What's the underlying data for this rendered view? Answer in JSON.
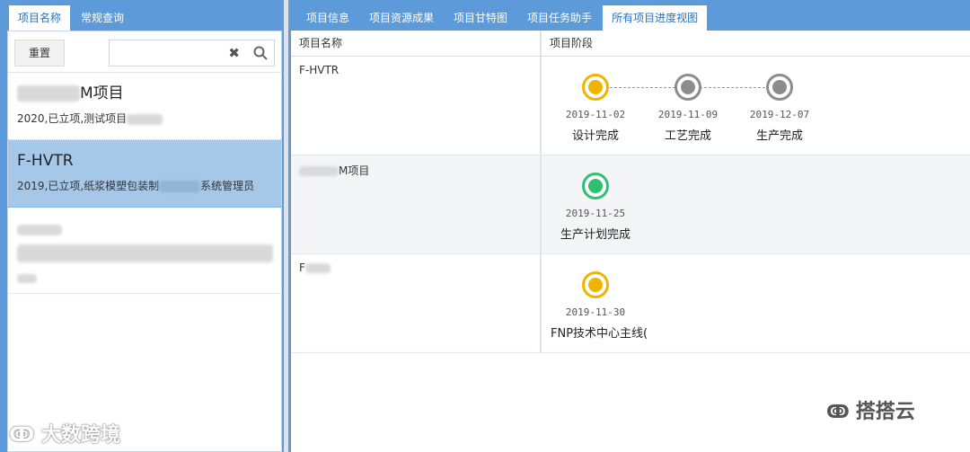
{
  "left_panel": {
    "tabs": [
      {
        "label": "项目名称",
        "active": true
      },
      {
        "label": "常规查询",
        "active": false
      }
    ],
    "reset_label": "重置",
    "search_value": "",
    "clear_icon": "✖",
    "projects": [
      {
        "title_suffix": "M项目",
        "subtitle": "2020,已立项,测试项目",
        "selected": false
      },
      {
        "title": "F-HVTR",
        "subtitle_a": "2019,已立项,纸浆模塑包装制",
        "subtitle_b": "系统管理员",
        "selected": true
      }
    ]
  },
  "right_panel": {
    "tabs": [
      {
        "label": "项目信息",
        "active": false
      },
      {
        "label": "项目资源成果",
        "active": false
      },
      {
        "label": "项目甘特图",
        "active": false
      },
      {
        "label": "项目任务助手",
        "active": false
      },
      {
        "label": "所有项目进度视图",
        "active": true
      }
    ],
    "columns": {
      "name": "项目名称",
      "stage": "项目阶段"
    },
    "rows": [
      {
        "name": "F-HVTR",
        "milestones": [
          {
            "date": "2019-11-02",
            "label": "设计完成",
            "color": "#f0b400"
          },
          {
            "date": "2019-11-09",
            "label": "工艺完成",
            "color": "#8c8c8c"
          },
          {
            "date": "2019-12-07",
            "label": "生产完成",
            "color": "#8c8c8c"
          }
        ]
      },
      {
        "name": "M项目",
        "milestones": [
          {
            "date": "2019-11-25",
            "label": "生产计划完成",
            "color": "#2fbf71"
          }
        ]
      },
      {
        "name": "F",
        "milestones": [
          {
            "date": "2019-11-30",
            "label": "FNP技术中心主线(",
            "color": "#f0b400"
          }
        ]
      }
    ]
  },
  "watermarks": {
    "left": "大数跨境",
    "right": "搭搭云"
  }
}
